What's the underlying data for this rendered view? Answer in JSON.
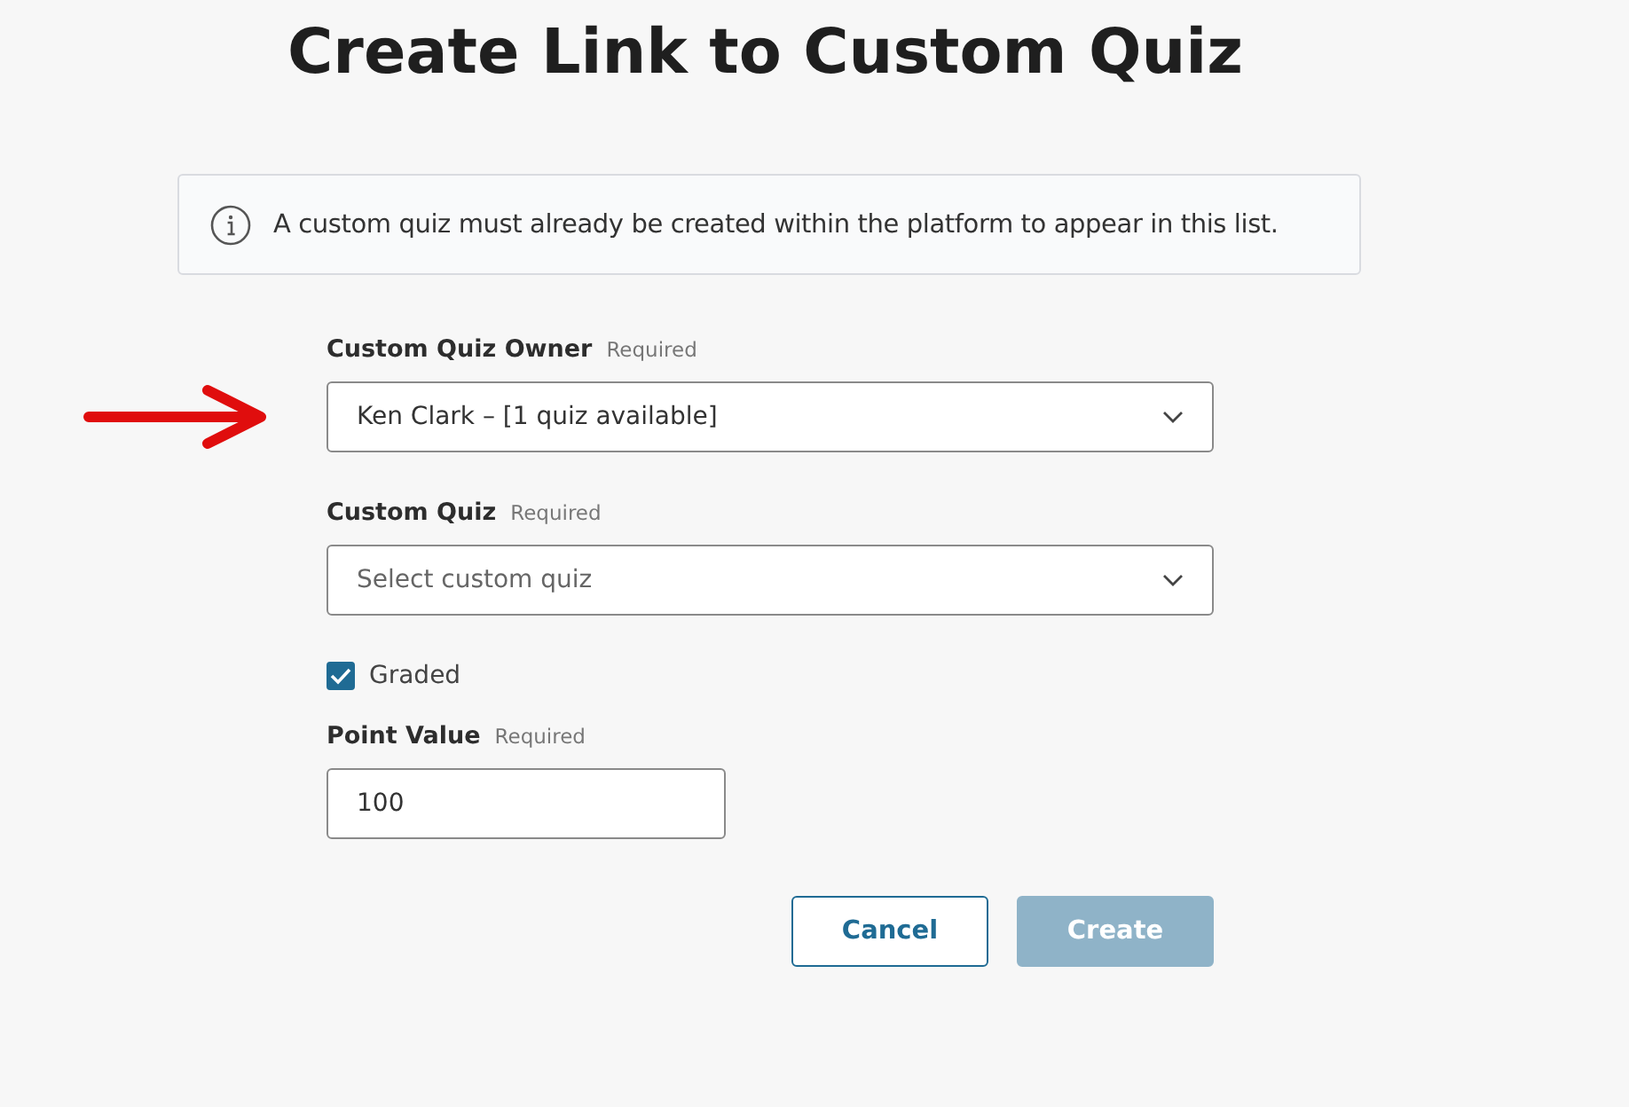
{
  "title": "Create Link to Custom Quiz",
  "info": "A custom quiz must already be created within the platform to appear in this list.",
  "fields": [
    {
      "kind": "select",
      "label": "Custom Quiz Owner",
      "required": "Required",
      "value": "Ken Clark – [1 quiz available]",
      "annotated": true
    },
    {
      "kind": "select",
      "label": "Custom Quiz",
      "required": "Required",
      "placeholder": "Select custom quiz",
      "annotated": false
    },
    {
      "kind": "checkbox",
      "label": "Graded",
      "checked": true
    },
    {
      "kind": "text",
      "label": "Point Value",
      "required": "Required",
      "value": "100"
    }
  ],
  "buttons": [
    {
      "label": "Cancel",
      "kind": "secondary",
      "disabled": false
    },
    {
      "label": "Create",
      "kind": "primary",
      "disabled": true
    }
  ]
}
